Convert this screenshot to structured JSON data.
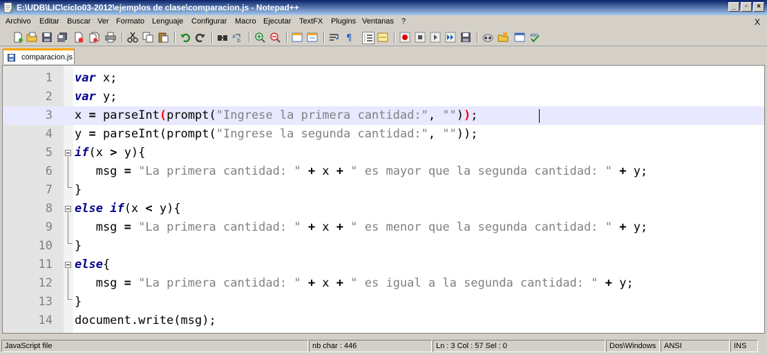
{
  "window": {
    "title": "E:\\UDB\\LIC\\ciclo03-2012\\ejemplos de clase\\comparacion.js - Notepad++",
    "minimize": "_",
    "restore": "▫",
    "close": "×"
  },
  "menu": [
    "Archivo",
    "Editar",
    "Buscar",
    "Ver",
    "Formato",
    "Lenguaje",
    "Configurar",
    "Macro",
    "Ejecutar",
    "TextFX",
    "Plugins",
    "Ventanas",
    "?"
  ],
  "menu_close": "X",
  "toolbar_icons": [
    "new-file-icon",
    "open-file-icon",
    "save-icon",
    "save-all-icon",
    "close-icon",
    "close-all-icon",
    "print-icon",
    "cut-icon",
    "copy-icon",
    "paste-icon",
    "undo-icon",
    "redo-icon",
    "find-icon",
    "replace-icon",
    "zoom-in-icon",
    "zoom-out-icon",
    "sync-v-icon",
    "sync-h-icon",
    "word-wrap-icon",
    "show-all-chars-icon",
    "indent-guide-icon",
    "user-lang-icon",
    "record-macro-icon",
    "stop-macro-icon",
    "play-macro-icon",
    "run-macro-multiple-icon",
    "save-macro-icon",
    "launch-browser-icon",
    "open-folder-icon",
    "console-icon",
    "spellcheck-icon"
  ],
  "tab": {
    "label": "comparacion.js"
  },
  "editor": {
    "line_numbers": [
      "1",
      "2",
      "3",
      "4",
      "5",
      "6",
      "7",
      "8",
      "9",
      "10",
      "11",
      "12",
      "13",
      "14"
    ],
    "current_line": 3
  },
  "status": {
    "file_type": "JavaScript file",
    "nb_char": "nb char : 446",
    "position": "Ln : 3    Col : 57    Sel : 0",
    "eol": "Dos\\Windows",
    "encoding": "ANSI",
    "mode": "INS"
  }
}
